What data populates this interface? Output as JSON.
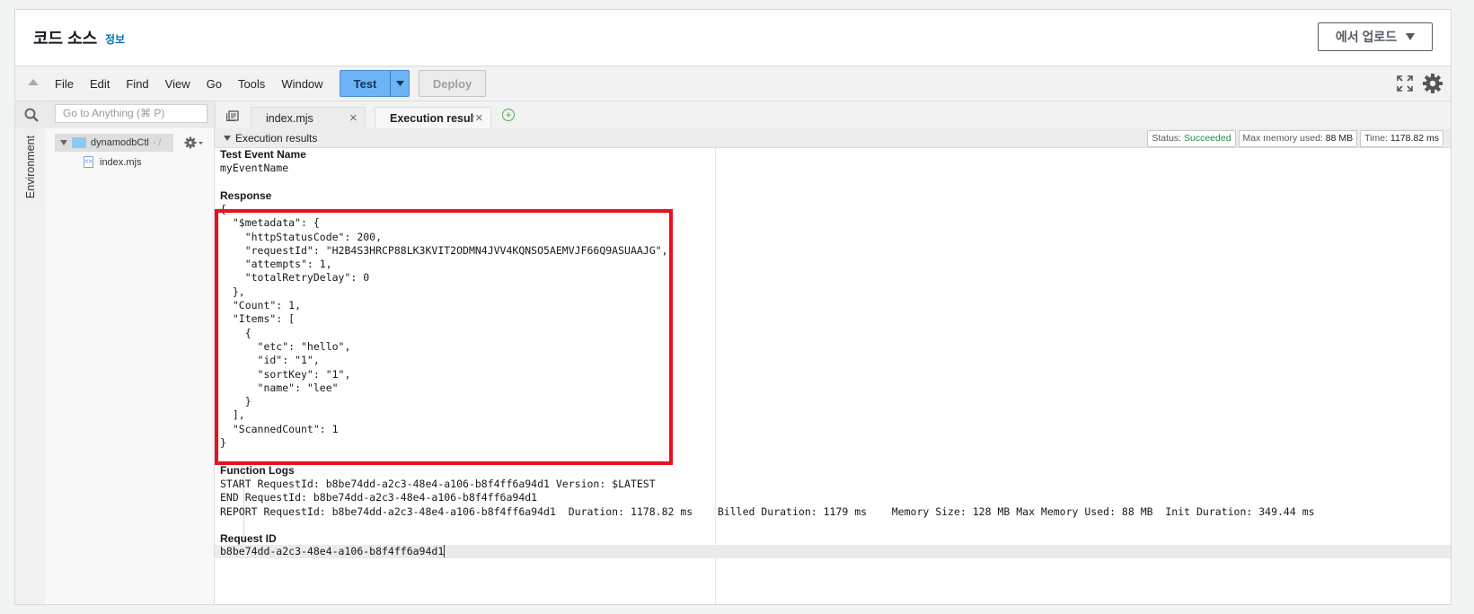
{
  "header": {
    "title": "코드 소스",
    "info_link": "정보",
    "upload_button": "에서 업로드"
  },
  "menubar": {
    "items": [
      "File",
      "Edit",
      "Find",
      "View",
      "Go",
      "Tools",
      "Window"
    ],
    "test_button": "Test",
    "deploy_button": "Deploy"
  },
  "sidebar": {
    "search_placeholder": "Go to Anything (⌘ P)",
    "environment_tab": "Environment",
    "root_folder": "dynamodbCtl",
    "root_separator": "- /",
    "file": "index.mjs"
  },
  "tabs": [
    {
      "label": "index.mjs"
    },
    {
      "label": "Execution results"
    }
  ],
  "results": {
    "title": "Execution results",
    "status_label": "Status:",
    "status_value": "Succeeded",
    "memory_label": "Max memory used:",
    "memory_value": "88 MB",
    "time_label": "Time:",
    "time_value": "1178.82 ms"
  },
  "execution": {
    "test_event_label": "Test Event Name",
    "test_event_value": "myEventName",
    "response_label": "Response",
    "response_body": "{\n  \"$metadata\": {\n    \"httpStatusCode\": 200,\n    \"requestId\": \"H2B4S3HRCP88LK3KVIT2ODMN4JVV4KQNSO5AEMVJF66Q9ASUAAJG\",\n    \"attempts\": 1,\n    \"totalRetryDelay\": 0\n  },\n  \"Count\": 1,\n  \"Items\": [\n    {\n      \"etc\": \"hello\",\n      \"id\": \"1\",\n      \"sortKey\": \"1\",\n      \"name\": \"lee\"\n    }\n  ],\n  \"ScannedCount\": 1\n}",
    "function_logs_label": "Function Logs",
    "function_logs": "START RequestId: b8be74dd-a2c3-48e4-a106-b8f4ff6a94d1 Version: $LATEST\nEND RequestId: b8be74dd-a2c3-48e4-a106-b8f4ff6a94d1\nREPORT RequestId: b8be74dd-a2c3-48e4-a106-b8f4ff6a94d1  Duration: 1178.82 ms    Billed Duration: 1179 ms    Memory Size: 128 MB Max Memory Used: 88 MB  Init Duration: 349.44 ms",
    "request_id_label": "Request ID",
    "request_id_value": "b8be74dd-a2c3-48e4-a106-b8f4ff6a94d1"
  },
  "colors": {
    "highlight": "#e8101f",
    "test_button": "#6cb4f5",
    "status_ok": "#1e8e3e",
    "link": "#0073bb"
  }
}
